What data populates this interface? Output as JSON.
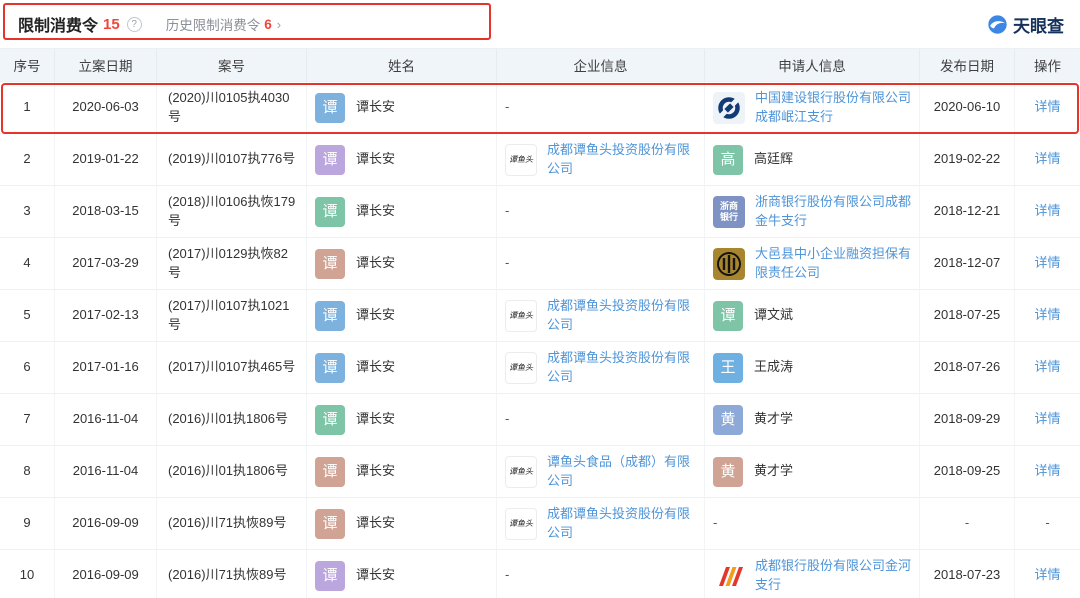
{
  "brand": {
    "name": "天眼查"
  },
  "header": {
    "title": "限制消费令",
    "count": "15",
    "help_icon": "?",
    "history_label": "历史限制消费令",
    "history_count": "6",
    "arrow": "›"
  },
  "table": {
    "columns": [
      "序号",
      "立案日期",
      "案号",
      "姓名",
      "企业信息",
      "申请人信息",
      "发布日期",
      "操作"
    ],
    "detail_label": "详情",
    "rows": [
      {
        "no": "1",
        "filing_date": "2020-06-03",
        "case_no": "(2020)川0105执4030号",
        "person": {
          "avatar_text": "谭",
          "avatar_color": "#7cb2dd",
          "name": "谭长安"
        },
        "company": {
          "type": "dash"
        },
        "applicant": {
          "type": "logo",
          "logo": "ccb",
          "text": "中国建设银行股份有限公司成都岷江支行",
          "link": true
        },
        "publish_date": "2020-06-10",
        "action": "详情",
        "highlighted": true
      },
      {
        "no": "2",
        "filing_date": "2019-01-22",
        "case_no": "(2019)川0107执776号",
        "person": {
          "avatar_text": "谭",
          "avatar_color": "#bca6de",
          "name": "谭长安"
        },
        "company": {
          "type": "logo",
          "logo": "tanyutou",
          "text": "成都谭鱼头投资股份有限公司",
          "link": true
        },
        "applicant": {
          "type": "avatar",
          "avatar_text": "高",
          "avatar_color": "#7dc5a6",
          "text": "高廷辉",
          "link": false
        },
        "publish_date": "2019-02-22",
        "action": "详情",
        "highlighted": false
      },
      {
        "no": "3",
        "filing_date": "2018-03-15",
        "case_no": "(2018)川0106执恢179号",
        "person": {
          "avatar_text": "谭",
          "avatar_color": "#7dc5a6",
          "name": "谭长安"
        },
        "company": {
          "type": "dash"
        },
        "applicant": {
          "type": "logo",
          "logo": "czb",
          "text": "浙商银行股份有限公司成都金牛支行",
          "link": true
        },
        "publish_date": "2018-12-21",
        "action": "详情",
        "highlighted": false
      },
      {
        "no": "4",
        "filing_date": "2017-03-29",
        "case_no": "(2017)川0129执恢82号",
        "person": {
          "avatar_text": "谭",
          "avatar_color": "#d0a394",
          "name": "谭长安"
        },
        "company": {
          "type": "dash"
        },
        "applicant": {
          "type": "logo",
          "logo": "dayi",
          "text": "大邑县中小企业融资担保有限责任公司",
          "link": true
        },
        "publish_date": "2018-12-07",
        "action": "详情",
        "highlighted": false
      },
      {
        "no": "5",
        "filing_date": "2017-02-13",
        "case_no": "(2017)川0107执1021号",
        "person": {
          "avatar_text": "谭",
          "avatar_color": "#7cb2dd",
          "name": "谭长安"
        },
        "company": {
          "type": "logo",
          "logo": "tanyutou",
          "text": "成都谭鱼头投资股份有限公司",
          "link": true
        },
        "applicant": {
          "type": "avatar",
          "avatar_text": "谭",
          "avatar_color": "#7dc5a6",
          "text": "谭文斌",
          "link": false
        },
        "publish_date": "2018-07-25",
        "action": "详情",
        "highlighted": false
      },
      {
        "no": "6",
        "filing_date": "2017-01-16",
        "case_no": "(2017)川0107执465号",
        "person": {
          "avatar_text": "谭",
          "avatar_color": "#7cb2dd",
          "name": "谭长安"
        },
        "company": {
          "type": "logo",
          "logo": "tanyutou",
          "text": "成都谭鱼头投资股份有限公司",
          "link": true
        },
        "applicant": {
          "type": "avatar",
          "avatar_text": "王",
          "avatar_color": "#6fb0e2",
          "text": "王成涛",
          "link": false
        },
        "publish_date": "2018-07-26",
        "action": "详情",
        "highlighted": false
      },
      {
        "no": "7",
        "filing_date": "2016-11-04",
        "case_no": "(2016)川01执1806号",
        "person": {
          "avatar_text": "谭",
          "avatar_color": "#7dc5a6",
          "name": "谭长安"
        },
        "company": {
          "type": "dash"
        },
        "applicant": {
          "type": "avatar",
          "avatar_text": "黄",
          "avatar_color": "#8ca9d8",
          "text": "黄才学",
          "link": false
        },
        "publish_date": "2018-09-29",
        "action": "详情",
        "highlighted": false
      },
      {
        "no": "8",
        "filing_date": "2016-11-04",
        "case_no": "(2016)川01执1806号",
        "person": {
          "avatar_text": "谭",
          "avatar_color": "#d0a394",
          "name": "谭长安"
        },
        "company": {
          "type": "logo",
          "logo": "tanyutou",
          "text": "谭鱼头食品（成都）有限公司",
          "link": true
        },
        "applicant": {
          "type": "avatar",
          "avatar_text": "黄",
          "avatar_color": "#d0a394",
          "text": "黄才学",
          "link": false
        },
        "publish_date": "2018-09-25",
        "action": "详情",
        "highlighted": false
      },
      {
        "no": "9",
        "filing_date": "2016-09-09",
        "case_no": "(2016)川71执恢89号",
        "person": {
          "avatar_text": "谭",
          "avatar_color": "#d0a394",
          "name": "谭长安"
        },
        "company": {
          "type": "logo",
          "logo": "tanyutou",
          "text": "成都谭鱼头投资股份有限公司",
          "link": true
        },
        "applicant": {
          "type": "dash"
        },
        "publish_date": "-",
        "action": "-",
        "highlighted": false
      },
      {
        "no": "10",
        "filing_date": "2016-09-09",
        "case_no": "(2016)川71执恢89号",
        "person": {
          "avatar_text": "谭",
          "avatar_color": "#bca6de",
          "name": "谭长安"
        },
        "company": {
          "type": "dash"
        },
        "applicant": {
          "type": "logo",
          "logo": "bocd",
          "text": "成都银行股份有限公司金河支行",
          "link": true
        },
        "publish_date": "2018-07-23",
        "action": "详情",
        "highlighted": false
      }
    ]
  }
}
